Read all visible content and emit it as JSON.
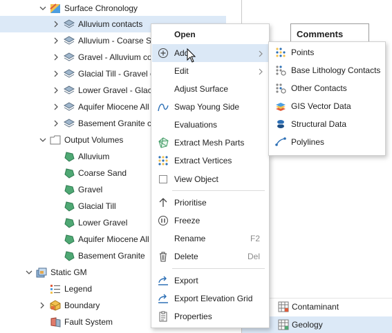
{
  "tree": {
    "surface_chronology": "Surface Chronology",
    "surfaces": [
      "Alluvium contacts",
      "Alluvium - Coarse Sa",
      "Gravel - Alluvium co",
      "Glacial Till - Gravel co",
      "Lower Gravel - Glaci",
      "Aquifer Miocene All",
      "Basement Granite c"
    ],
    "output_volumes": "Output Volumes",
    "volumes": [
      "Alluvium",
      "Coarse Sand",
      "Gravel",
      "Glacial Till",
      "Lower Gravel",
      "Aquifer Miocene All",
      "Basement Granite"
    ],
    "static_gm": "Static GM",
    "gm_children": [
      "Legend",
      "Boundary",
      "Fault System"
    ]
  },
  "right_panel": {
    "comments": "Comments",
    "rows": [
      "Contaminant",
      "Geology"
    ]
  },
  "context_menu": {
    "open": "Open",
    "add": "Add",
    "edit": "Edit",
    "adjust_surface": "Adjust Surface",
    "swap_young_side": "Swap Young Side",
    "evaluations": "Evaluations",
    "extract_mesh_parts": "Extract Mesh Parts",
    "extract_vertices": "Extract Vertices",
    "view_object": "View Object",
    "prioritise": "Prioritise",
    "freeze": "Freeze",
    "rename": "Rename",
    "rename_shortcut": "F2",
    "delete": "Delete",
    "delete_shortcut": "Del",
    "export": "Export",
    "export_elevation_grid": "Export Elevation Grid",
    "properties": "Properties"
  },
  "add_submenu": [
    "Points",
    "Base Lithology Contacts",
    "Other Contacts",
    "GIS Vector Data",
    "Structural Data",
    "Polylines"
  ],
  "colors": {
    "selection": "#dce9f7",
    "accent": "#2c6fb5",
    "volume_green": "#4fa874"
  }
}
